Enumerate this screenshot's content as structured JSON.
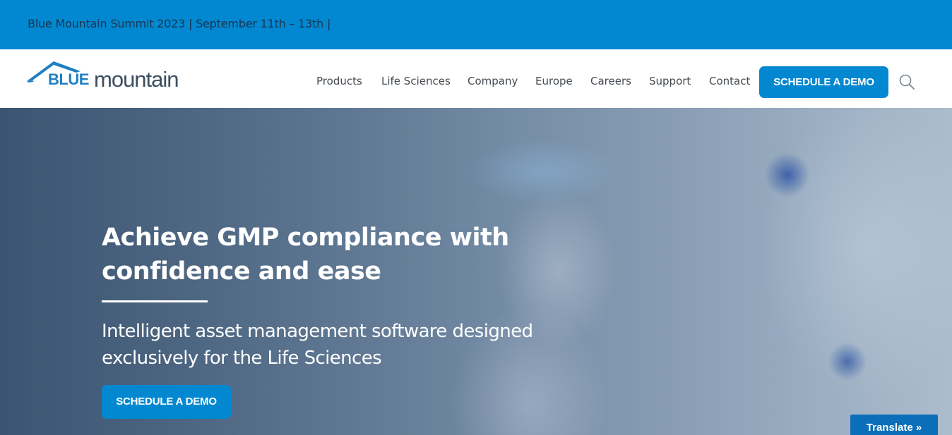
{
  "announcement": {
    "text": "Blue Mountain Summit 2023 | September 11th – 13th |"
  },
  "logo": {
    "blue": "BLUE",
    "mountain": "mountain",
    "icon": "roof-icon"
  },
  "nav": {
    "items": [
      {
        "label": "Products"
      },
      {
        "label": "Life Sciences"
      },
      {
        "label": "Company"
      },
      {
        "label": "Europe"
      },
      {
        "label": "Careers"
      },
      {
        "label": "Support"
      },
      {
        "label": "Contact"
      }
    ],
    "cta_label": "SCHEDULE A DEMO",
    "search_icon": "search-icon"
  },
  "hero": {
    "title": "Achieve GMP compliance with confidence and ease",
    "subtitle": "Intelligent asset management software designed exclusively for the Life Sciences",
    "cta_label": "SCHEDULE A DEMO"
  },
  "translate": {
    "label": "Translate »"
  },
  "colors": {
    "brand_blue": "#0288d1",
    "logo_gray": "#3c4e60",
    "text_dark": "#444b52"
  }
}
